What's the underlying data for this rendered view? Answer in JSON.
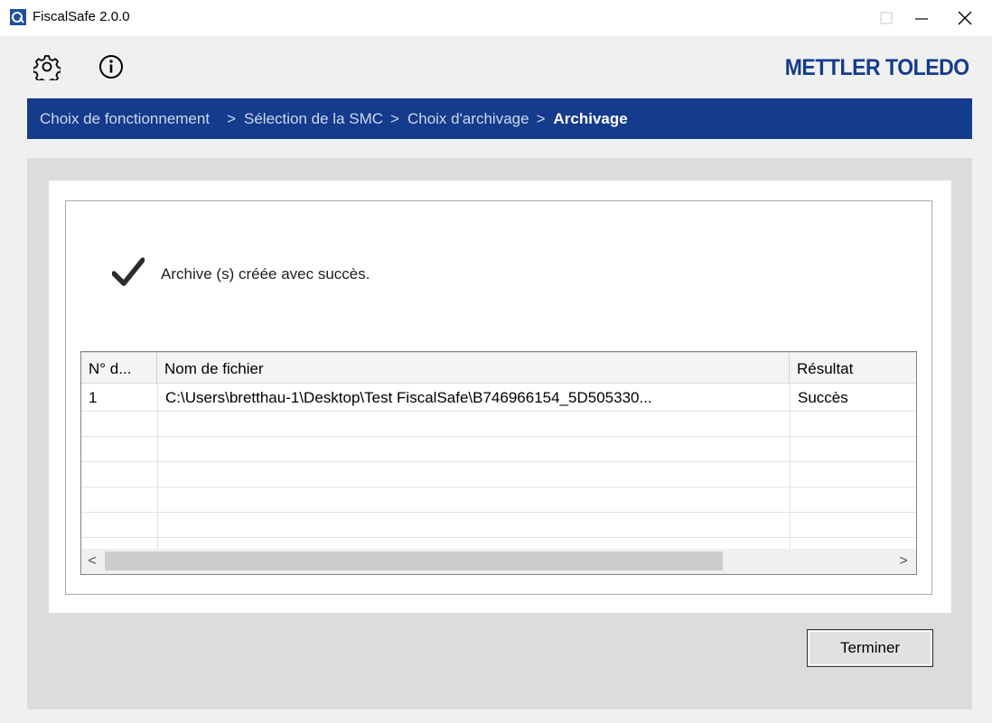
{
  "window": {
    "title": "FiscalSafe 2.0.0",
    "icon": "app-shield-icon",
    "controls": [
      "minimize-icon",
      "maximize-icon",
      "close-icon"
    ]
  },
  "toolbar": {
    "settings_icon": "gear-icon",
    "info_icon": "info-icon",
    "brand": "METTLER TOLEDO"
  },
  "breadcrumb": {
    "separator": ">",
    "steps": [
      "Choix de fonctionnement",
      "Sélection de la SMC",
      "Choix d'archivage",
      "Archivage"
    ],
    "current_index": 3
  },
  "status": {
    "icon": "checkmark-icon",
    "message": "Archive (s) créée avec succès."
  },
  "table": {
    "columns": [
      "N° d...",
      "Nom de fichier",
      "Résultat"
    ],
    "rows": [
      [
        "1",
        "C:\\Users\\bretthau-1\\Desktop\\Test FiscalSafe\\B746966154_5D505330...",
        "Succès"
      ]
    ],
    "scroll_left": "<",
    "scroll_right": ">"
  },
  "actions": {
    "finish_label": "Terminer"
  },
  "colors": {
    "brand_blue": "#143b8c",
    "panel_gray": "#dcdcdc"
  }
}
